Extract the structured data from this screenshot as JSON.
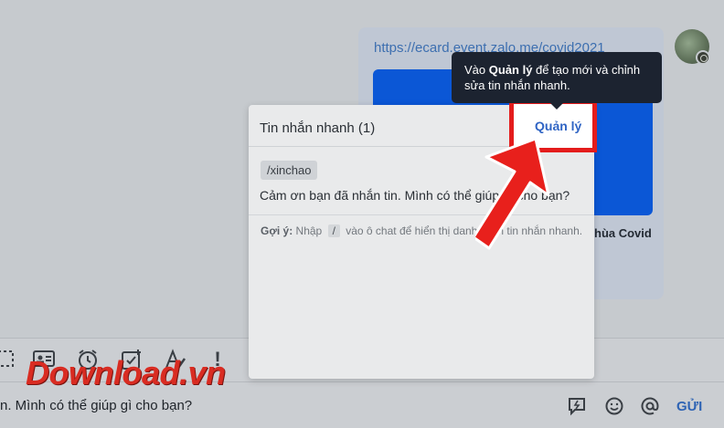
{
  "chat": {
    "message_link": "https://ecard.event.zalo.me/covid2021",
    "message_caption": "hùa Covid"
  },
  "tooltip": {
    "prefix": "Vào ",
    "bold": "Quản lý",
    "suffix": " để tạo mới và chỉnh sửa tin nhắn nhanh."
  },
  "quick_replies": {
    "title": "Tin nhắn nhanh (1)",
    "manage_label": "Quản lý",
    "items": [
      {
        "shortcut": "/xinchao",
        "message": "Cảm ơn bạn đã nhắn tin. Mình có thể giúp gì cho bạn?"
      }
    ],
    "hint_label": "Gợi ý:",
    "hint_before": " Nhập ",
    "hint_key": "/",
    "hint_after": " vào ô chat để hiển thị danh sách tin nhắn nhanh."
  },
  "composer": {
    "text": "n. Mình có thể giúp gì cho bạn?",
    "send_label": "GỬI"
  },
  "toolbar": {
    "icons": [
      "screenshot-icon",
      "contact-card-icon",
      "reminder-clock-icon",
      "task-checkbox-icon",
      "text-format-icon",
      "important-icon"
    ]
  },
  "watermark": {
    "main": "Download",
    "tld": ".vn"
  },
  "colors": {
    "accent": "#2f64c4",
    "highlight": "#e41c1c",
    "tooltip_bg": "#1c2330"
  }
}
